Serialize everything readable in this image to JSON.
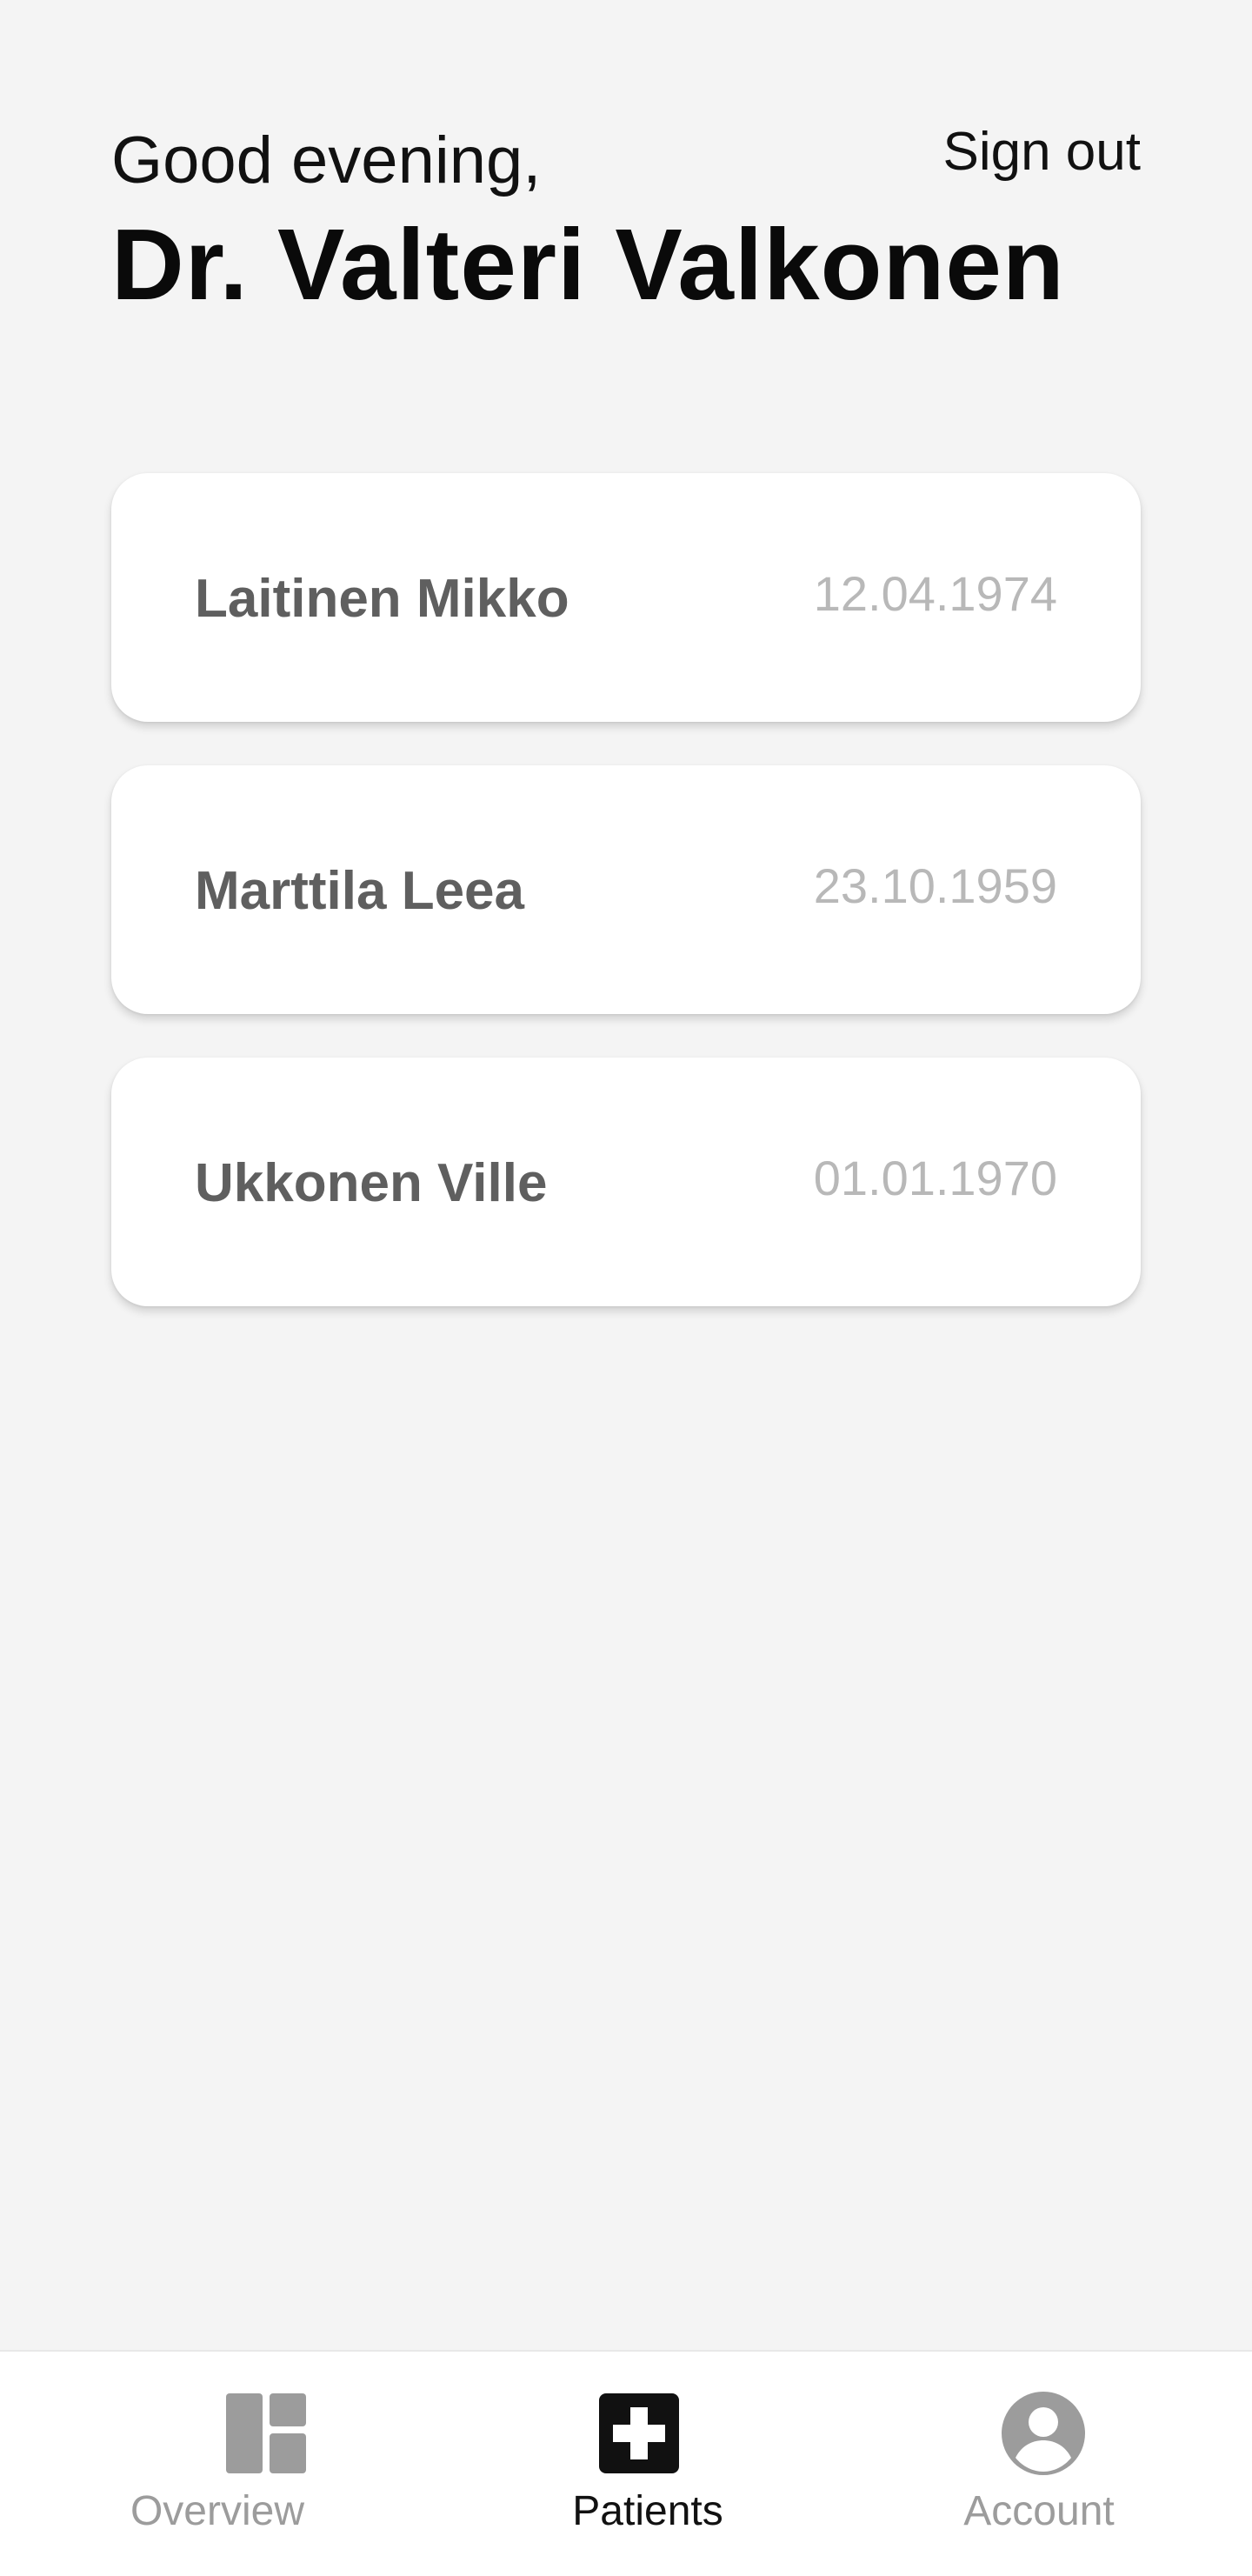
{
  "header": {
    "greeting": "Good evening,",
    "doctor_name": "Dr. Valteri Valkonen",
    "sign_out_label": "Sign out"
  },
  "patients": [
    {
      "name": "Laitinen Mikko",
      "dob": "12.04.1974"
    },
    {
      "name": "Marttila Leea",
      "dob": "23.10.1959"
    },
    {
      "name": "Ukkonen Ville",
      "dob": "01.01.1970"
    }
  ],
  "nav": {
    "items": [
      {
        "label": "Overview",
        "icon": "dashboard-icon",
        "active": false
      },
      {
        "label": "Patients",
        "icon": "medical-cross-icon",
        "active": true
      },
      {
        "label": "Account",
        "icon": "account-circle-icon",
        "active": false
      }
    ]
  },
  "colors": {
    "background": "#f4f4f4",
    "card": "#ffffff",
    "patient_name": "#5f5f5f",
    "patient_dob": "#b8b8b8",
    "nav_active": "#111111",
    "nav_inactive": "#9c9c9c"
  }
}
